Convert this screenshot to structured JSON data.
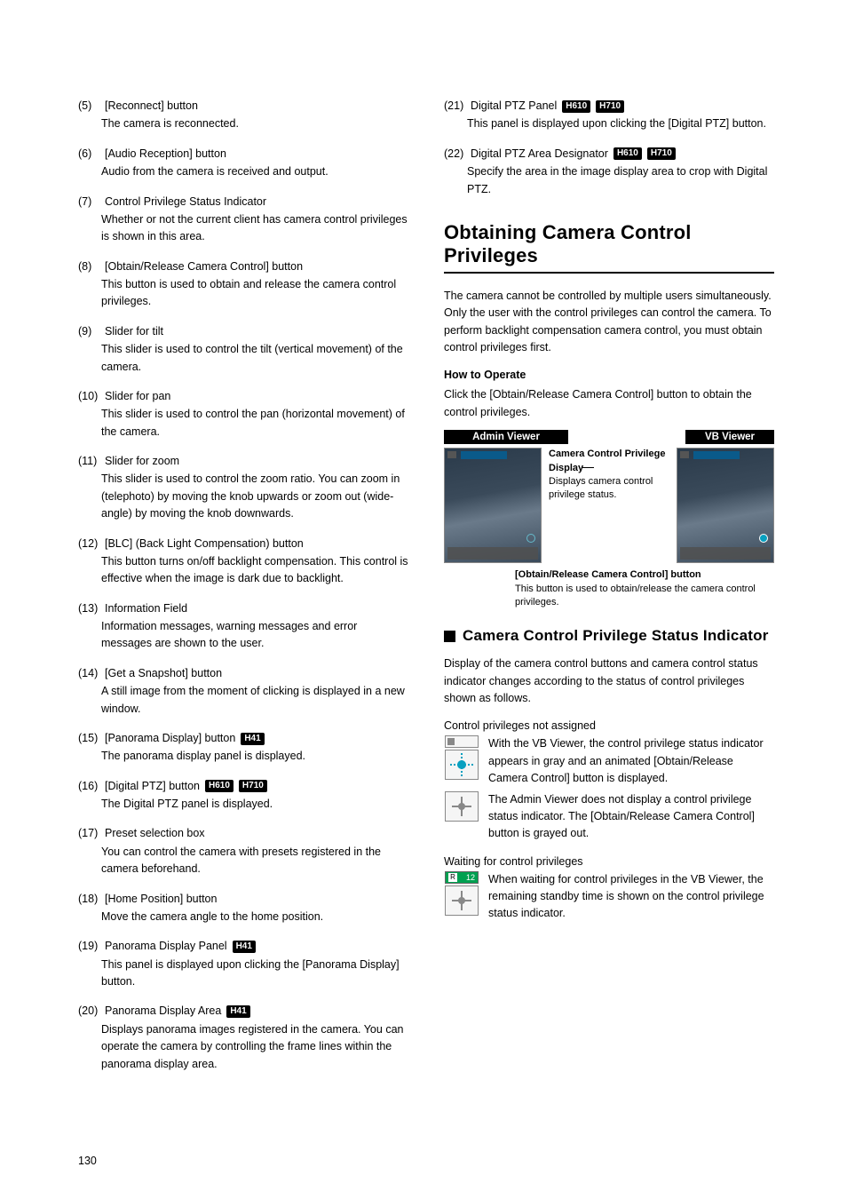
{
  "tags": {
    "h41": "H41",
    "h610": "H610",
    "h710": "H710"
  },
  "left_items": [
    {
      "num": "(5)",
      "title": "[Reconnect] button",
      "desc": "The camera is reconnected.",
      "tags": []
    },
    {
      "num": "(6)",
      "title": "[Audio Reception] button",
      "desc": "Audio from the camera is received and output.",
      "tags": []
    },
    {
      "num": "(7)",
      "title": "Control Privilege Status Indicator",
      "desc": "Whether or not the current client has camera control privileges is shown in this area.",
      "tags": []
    },
    {
      "num": "(8)",
      "title": "[Obtain/Release Camera Control] button",
      "desc": "This button is used to obtain and release the camera control privileges.",
      "tags": []
    },
    {
      "num": "(9)",
      "title": "Slider for tilt",
      "desc": "This slider is used to control the tilt (vertical movement) of the camera.",
      "tags": []
    },
    {
      "num": "(10)",
      "title": "Slider for pan",
      "desc": "This slider is used to control the pan (horizontal movement) of the camera.",
      "tags": []
    },
    {
      "num": "(11)",
      "title": "Slider for zoom",
      "desc": "This slider is used to control the zoom ratio. You can zoom in (telephoto) by moving the knob upwards or zoom out (wide-angle) by moving the knob downwards.",
      "tags": []
    },
    {
      "num": "(12)",
      "title": "[BLC] (Back Light Compensation) button",
      "desc": "This button turns on/off backlight compensation. This control is effective when the image is dark due to backlight.",
      "tags": []
    },
    {
      "num": "(13)",
      "title": "Information Field",
      "desc": "Information messages, warning messages and error messages are shown to the user.",
      "tags": []
    },
    {
      "num": "(14)",
      "title": "[Get a Snapshot] button",
      "desc": "A still image from the moment of clicking is displayed in a new window.",
      "tags": []
    },
    {
      "num": "(15)",
      "title": "[Panorama Display] button",
      "desc": "The panorama display panel is displayed.",
      "tags": [
        "h41"
      ]
    },
    {
      "num": "(16)",
      "title": "[Digital PTZ] button",
      "desc": "The Digital PTZ panel is displayed.",
      "tags": [
        "h610",
        "h710"
      ]
    },
    {
      "num": "(17)",
      "title": "Preset selection box",
      "desc": "You can control the camera with presets registered in the camera beforehand.",
      "tags": []
    },
    {
      "num": "(18)",
      "title": "[Home Position] button",
      "desc": "Move the camera angle to the home position.",
      "tags": []
    },
    {
      "num": "(19)",
      "title": "Panorama Display Panel",
      "desc": "This panel is displayed upon clicking the [Panorama Display] button.",
      "tags": [
        "h41"
      ]
    },
    {
      "num": "(20)",
      "title": "Panorama Display Area",
      "desc": "Displays panorama images registered in the camera. You can operate the camera by controlling the frame lines within the panorama display area.",
      "tags": [
        "h41"
      ]
    }
  ],
  "right_items": [
    {
      "num": "(21)",
      "title": "Digital PTZ Panel",
      "desc": "This panel is displayed upon clicking the [Digital PTZ] button.",
      "tags": [
        "h610",
        "h710"
      ]
    },
    {
      "num": "(22)",
      "title": "Digital PTZ Area Designator",
      "desc": "Specify the area in the image display area to crop with Digital PTZ.",
      "tags": [
        "h610",
        "h710"
      ]
    }
  ],
  "section": {
    "heading": "Obtaining Camera Control Privileges",
    "body": "The camera cannot be controlled by multiple users simultaneously. Only the user with the control privileges can control the camera. To perform backlight compensation camera control, you must obtain control privileges first.",
    "how_title": "How to Operate",
    "how_body": "Click the [Obtain/Release Camera Control] button to obtain the control privileges.",
    "admin_label": "Admin Viewer",
    "vb_label": "VB Viewer",
    "annot1_title": "Camera Control Privilege Display",
    "annot1_body": "Displays camera control privilege status.",
    "annot2_title": "[Obtain/Release Camera Control] button",
    "annot2_body": "This button is used to obtain/release the camera control privileges.",
    "sub_heading": "Camera Control Privilege Status Indicator",
    "sub_body": "Display of the camera control buttons and camera control status indicator changes according to the status of control privileges shown as follows.",
    "status1_title": "Control privileges not assigned",
    "status1_a": "With the VB Viewer, the control privilege status indicator appears in gray and an animated [Obtain/Release Camera Control] button is displayed.",
    "status1_b": "The Admin Viewer does not display a control privilege status indicator. The [Obtain/Release Camera Control] button is grayed out.",
    "status2_title": "Waiting for control privileges",
    "status2_a": "When waiting for control privileges in the VB Viewer, the remaining standby time is shown on the control privilege status indicator.",
    "wait_time": "12"
  },
  "page_number": "130"
}
